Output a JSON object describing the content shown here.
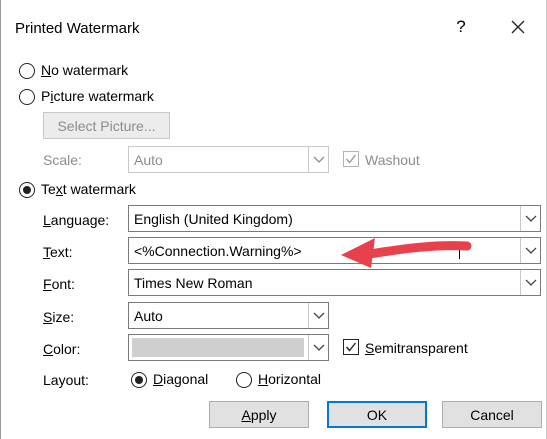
{
  "window": {
    "title": "Printed Watermark",
    "help_label": "?"
  },
  "options": {
    "no_watermark": {
      "prefix": "",
      "accel": "N",
      "rest": "o watermark",
      "checked": false
    },
    "picture_watermark": {
      "prefix": "P",
      "accel": "i",
      "rest": "cture watermark",
      "checked": false
    },
    "text_watermark": {
      "prefix": "Te",
      "accel": "x",
      "rest": "t watermark",
      "checked": true
    }
  },
  "picture": {
    "select_picture_label": "Select Picture...",
    "scale_label": "Scale:",
    "scale_value": "Auto",
    "washout_label": "Washout",
    "washout_checked": true
  },
  "text": {
    "language_label": {
      "accel": "L",
      "rest": "anguage:"
    },
    "language_value": "English (United Kingdom)",
    "text_label": {
      "accel": "T",
      "rest": "ext:"
    },
    "text_value": "<%Connection.Warning%>",
    "font_label": {
      "accel": "F",
      "rest": "ont:"
    },
    "font_value": "Times New Roman",
    "size_label": {
      "accel": "S",
      "rest": "ize:"
    },
    "size_value": "Auto",
    "color_label": {
      "accel": "C",
      "rest": "olor:"
    },
    "semitransparent": {
      "accel": "S",
      "rest": "emitransparent",
      "checked": true
    },
    "layout_label": "Layout:",
    "layout_diagonal": {
      "accel": "D",
      "rest": "iagonal",
      "checked": true
    },
    "layout_horizontal": {
      "accel": "H",
      "rest": "orizontal",
      "checked": false
    }
  },
  "buttons": {
    "apply": {
      "accel": "A",
      "rest": "pply"
    },
    "ok": "OK",
    "cancel": "Cancel"
  },
  "colors": {
    "annotation_arrow": "#e8414b",
    "primary_border": "#0078d7",
    "disabled_text": "#8c8c8c"
  },
  "icons": {
    "close": "close-icon",
    "dropdown": "chevron-down-icon",
    "check": "check-icon",
    "annotation": "red-arrow-annotation"
  }
}
